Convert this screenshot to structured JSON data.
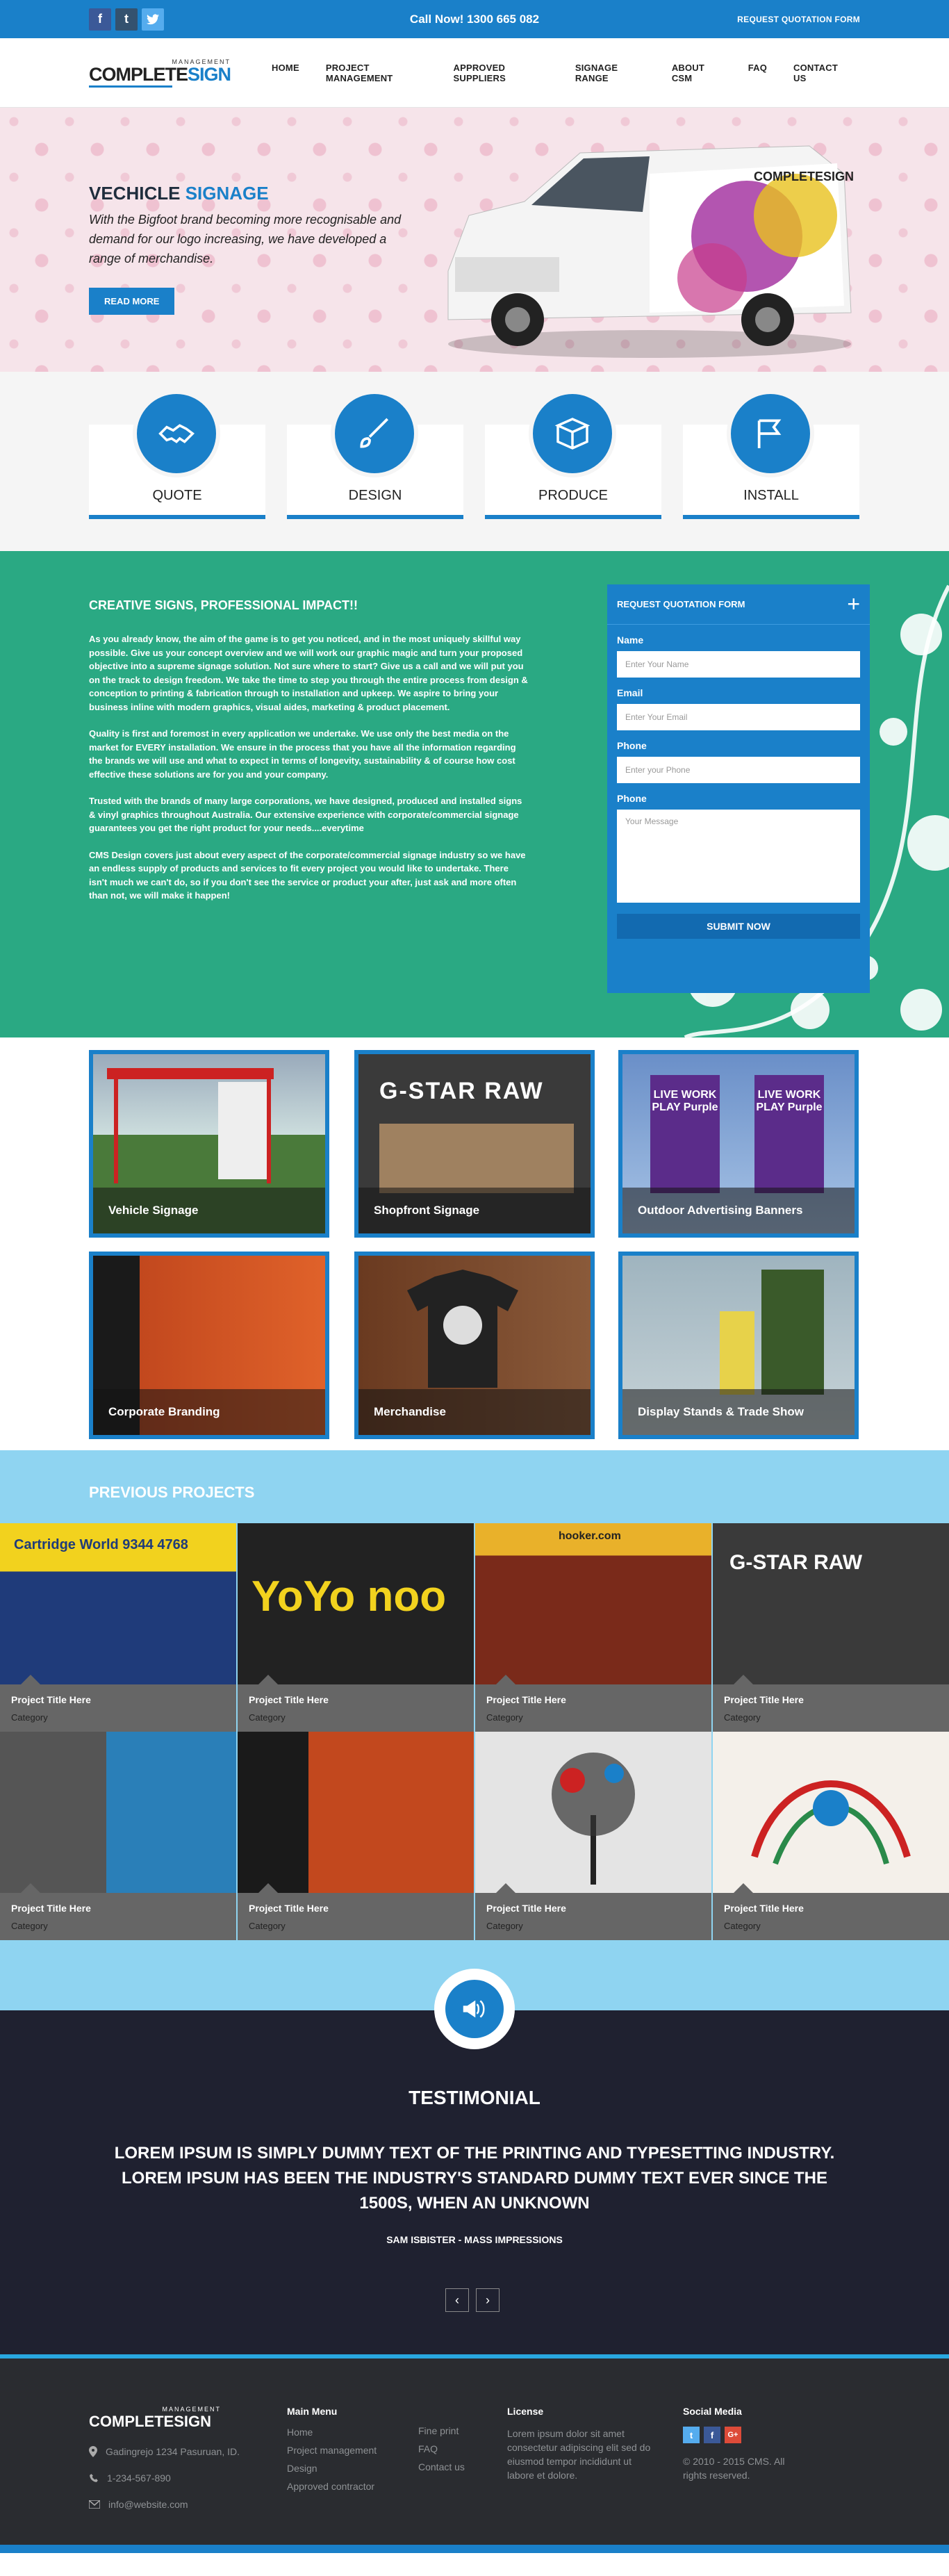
{
  "topbar": {
    "social": [
      {
        "name": "facebook-icon",
        "glyph": "f"
      },
      {
        "name": "tumblr-icon",
        "glyph": "t"
      },
      {
        "name": "twitter-icon",
        "glyph": "🐦"
      }
    ],
    "call": "Call Now! 1300 665 082",
    "quote_link": "REQUEST QUOTATION FORM"
  },
  "logo": {
    "management": "MANAGEMENT",
    "complete": "COMPLETE",
    "sign": "SIGN"
  },
  "nav": {
    "items": [
      "HOME",
      "PROJECT MANAGEMENT",
      "APPROVED SUPPLIERS",
      "SIGNAGE RANGE",
      "ABOUT CSM",
      "FAQ",
      "CONTACT US"
    ]
  },
  "hero": {
    "title_a": "VECHICLE",
    "title_b": "SIGNAGE",
    "text": "With the Bigfoot brand becoming more recognisable and demand for our logo increasing, we have developed a range of merchandise.",
    "button": "READ MORE",
    "van_logo": "COMPLETESIGN"
  },
  "services": [
    {
      "label": "QUOTE",
      "icon": "handshake-icon"
    },
    {
      "label": "DESIGN",
      "icon": "brush-icon"
    },
    {
      "label": "PRODUCE",
      "icon": "box-icon"
    },
    {
      "label": "INSTALL",
      "icon": "flag-icon"
    }
  ],
  "about": {
    "title": "CREATIVE SIGNS, PROFESSIONAL IMPACT!!",
    "paragraphs": [
      "As you already know, the aim of the game is to get you noticed, and in the most uniquely skillful way possible. Give us your concept overview and we will work our graphic magic and turn your proposed objective into a supreme signage solution. Not sure where to start? Give us a call and we will put you on the track to design freedom. We take the time to step you through the entire process from design & conception to printing & fabrication through to installation and upkeep. We aspire to bring your business inline with modern graphics, visual aides, marketing & product placement.",
      "Quality is first and foremost in every application we undertake. We use only the best media on the market for EVERY installation. We ensure in the process that you have all the information regarding the brands we will use and what to expect in terms of longevity, sustainability & of course how cost effective these solutions are for you and your company.",
      "Trusted with the brands of many large corporations, we have designed, produced and installed signs & vinyl graphics throughout Australia. Our extensive experience with corporate/commercial signage guarantees you get the right product for your needs....everytime",
      "CMS Design covers just about every aspect of the corporate/commercial signage industry so we have an endless supply of products and services to fit every project you would like to undertake. There isn't much we can't do, so if you don't see the service or product your after, just ask and more often than not, we will make it happen!"
    ]
  },
  "form": {
    "title": "REQUEST QUOTATION FORM",
    "name_label": "Name",
    "name_ph": "Enter Your Name",
    "email_label": "Email",
    "email_ph": "Enter Your Email",
    "phone_label": "Phone",
    "phone_ph": "Enter your Phone",
    "msg_label": "Phone",
    "msg_ph": "Your Message",
    "submit": "SUBMIT NOW"
  },
  "gallery": [
    {
      "label": "Vehicle Signage",
      "color": "#9aa7ae"
    },
    {
      "label": "Shopfront Signage",
      "color": "#3a3a3a",
      "sign": "G-STAR RAW"
    },
    {
      "label": "Outdoor Advertising Banners",
      "color": "#6a4a9a",
      "sign": "LIVE WORK PLAY Purple"
    },
    {
      "label": "Corporate Branding",
      "color": "#c2481e"
    },
    {
      "label": "Merchandise",
      "color": "#7a4a2a"
    },
    {
      "label": "Display Stands & Trade Show",
      "color": "#8aa6b0"
    }
  ],
  "projects": {
    "title": "PREVIOUS PROJECTS",
    "items": [
      {
        "title": "Project Title Here",
        "category": "Category",
        "color": "#1f3b7a",
        "sign": "Cartridge World 9344 4768"
      },
      {
        "title": "Project Title Here",
        "category": "Category",
        "color": "#222222",
        "sign": "YoYo noo"
      },
      {
        "title": "Project Title Here",
        "category": "Category",
        "color": "#7a2a1a",
        "sign": "hooker.com"
      },
      {
        "title": "Project Title Here",
        "category": "Category",
        "color": "#3a3a3a",
        "sign": "G-STAR RAW"
      },
      {
        "title": "Project Title Here",
        "category": "Category",
        "color": "#2a7fb8"
      },
      {
        "title": "Project Title Here",
        "category": "Category",
        "color": "#c2481e"
      },
      {
        "title": "Project Title Here",
        "category": "Category",
        "color": "#dddddd"
      },
      {
        "title": "Project Title Here",
        "category": "Category",
        "color": "#f4f0ea"
      }
    ]
  },
  "testimonial": {
    "title": "TESTIMONIAL",
    "quote": "LOREM IPSUM IS SIMPLY DUMMY TEXT OF THE PRINTING AND TYPESETTING INDUSTRY. LOREM IPSUM HAS BEEN THE INDUSTRY'S STANDARD DUMMY TEXT EVER SINCE THE 1500S, WHEN AN UNKNOWN",
    "author": "SAM ISBISTER - MASS IMPRESSIONS",
    "prev": "‹",
    "next": "›"
  },
  "footer": {
    "logo_mgmt": "MANAGEMENT",
    "logo_name": "COMPLETESIGN",
    "address": "Gadingrejo 1234 Pasuruan, ID.",
    "phone": "1-234-567-890",
    "email": "info@website.com",
    "main_menu_title": "Main Menu",
    "menu_col1": [
      "Home",
      "Project management",
      "Design",
      "Approved contractor"
    ],
    "menu_col2": [
      "Fine print",
      "FAQ",
      "Contact us"
    ],
    "license_title": "License",
    "license_text": "Lorem ipsum dolor sit amet consectetur adipiscing elit sed do eiusmod tempor incididunt ut labore et dolore.",
    "social_title": "Social Media",
    "copyright": "© 2010 - 2015 CMS. All rights reserved."
  },
  "colors": {
    "primary": "#1a80c9",
    "green": "#2aa983",
    "light_blue": "#8fd4f1",
    "dark": "#1f2130"
  }
}
